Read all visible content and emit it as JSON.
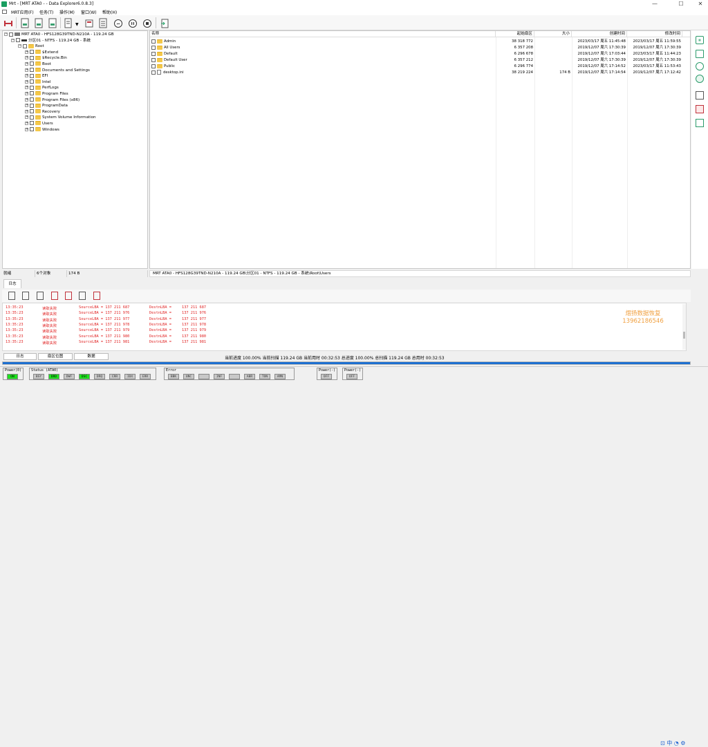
{
  "window": {
    "title": "Mrt - [MRT ATA0 -  - Data Explorer6.0.8.3]",
    "minimize_glyph": "—",
    "maximize_glyph": "☐",
    "close_glyph": "✕"
  },
  "menu": [
    "MRT应用(F)",
    "任务(T)",
    "操作(M)",
    "窗口(W)",
    "帮助(H)"
  ],
  "toolbar_icons": [
    "disk-icon",
    "document-icon",
    "document-icon",
    "document-icon",
    "document-dropdown-icon",
    "copy-icon",
    "list-icon",
    "fast-backward-icon",
    "pause-icon",
    "stop-icon",
    "exit-icon"
  ],
  "tree": {
    "disk": "MRT ATA0 - HFS128G39TND-N210A - 119.24 GB",
    "partition": "分区01 - NTFS - 119.24 GB - 系统",
    "root": "Root",
    "folders": [
      "$Extend",
      "$Recycle.Bin",
      "Boot",
      "Documents and Settings",
      "EFI",
      "Intel",
      "PerfLogs",
      "Program Files",
      "Program Files (x86)",
      "ProgramData",
      "Recovery",
      "System Volume Information",
      "Users",
      "Windows"
    ]
  },
  "filelist": {
    "columns": {
      "name": "名称",
      "start_sector": "起始扇区",
      "size": "大小",
      "created": "创建时间",
      "modified": "修改时间"
    },
    "rows": [
      {
        "name": "Admin",
        "start": "38 318 772",
        "size": "",
        "created": "2023/03/17 周五 11:45:48",
        "modified": "2023/03/17 周五 11:59:55",
        "type": "folder"
      },
      {
        "name": "All Users",
        "start": "6 357 208",
        "size": "",
        "created": "2019/12/07 周六 17:30:39",
        "modified": "2019/12/07 周六 17:30:39",
        "type": "folder"
      },
      {
        "name": "Default",
        "start": "6 296 678",
        "size": "",
        "created": "2019/12/07 周六 17:03:44",
        "modified": "2023/03/17 周五 11:44:23",
        "type": "folder"
      },
      {
        "name": "Default User",
        "start": "6 357 212",
        "size": "",
        "created": "2019/12/07 周六 17:30:39",
        "modified": "2019/12/07 周六 17:30:39",
        "type": "folder"
      },
      {
        "name": "Public",
        "start": "6 296 774",
        "size": "",
        "created": "2019/12/07 周六 17:14:52",
        "modified": "2023/03/17 周五 11:53:43",
        "type": "folder"
      },
      {
        "name": "desktop.ini",
        "start": "38 219 224",
        "size": "174 B",
        "created": "2019/12/07 周六 17:14:54",
        "modified": "2019/12/07 周六 17:12:42",
        "type": "file"
      }
    ]
  },
  "status": {
    "ready": "就绪",
    "count": "6个对象",
    "size": "174 B",
    "path": "MRT ATA0 - HFS128G39TND-N210A - 119.24 GB\\分区01 - NTFS - 119.24 GB - 系统\\Root\\Users"
  },
  "log": {
    "tab": "日志",
    "rows": [
      {
        "time": "13:35:23",
        "msg": "读取失败",
        "src": "SourceLBA = 137 211 687",
        "dst_label": "DestnLBA =",
        "dst": "137 211 687"
      },
      {
        "time": "13:35:23",
        "msg": "读取失败",
        "src": "SourceLBA = 137 211 976",
        "dst_label": "DestnLBA =",
        "dst": "137 211 976"
      },
      {
        "time": "13:35:23",
        "msg": "读取失败",
        "src": "SourceLBA = 137 211 977",
        "dst_label": "DestnLBA =",
        "dst": "137 211 977"
      },
      {
        "time": "13:35:23",
        "msg": "读取失败",
        "src": "SourceLBA = 137 211 978",
        "dst_label": "DestnLBA =",
        "dst": "137 211 978"
      },
      {
        "time": "13:35:23",
        "msg": "读取失败",
        "src": "SourceLBA = 137 211 979",
        "dst_label": "DestnLBA =",
        "dst": "137 211 979"
      },
      {
        "time": "13:35:23",
        "msg": "读取失败",
        "src": "SourceLBA = 137 211 980",
        "dst_label": "DestnLBA =",
        "dst": "137 211 980"
      },
      {
        "time": "13:35:23",
        "msg": "读取失败",
        "src": "SourceLBA = 137 211 981",
        "dst_label": "DestnLBA =",
        "dst": "137 211 981"
      }
    ],
    "watermark_line1": "熠扬数据恢复",
    "watermark_line2": "13962186546"
  },
  "bottom_tabs": [
    "日志",
    "扇区位图",
    "数据"
  ],
  "progress": {
    "text": "当前进度 100.00% 当前扫描 119.24 GB 当前用时 00:32:53   总进度 100.00% 总扫描 119.24 GB 总用时 00:32:53",
    "percent": 100,
    "fill_color": "#1d6fd0"
  },
  "statusbar": {
    "power0": {
      "label": "Power(0)",
      "indicators": [
        {
          "t": "ON",
          "on": true
        }
      ]
    },
    "status": {
      "label": "Status (ATA0)",
      "indicators": [
        {
          "t": "BSY",
          "on": false
        },
        {
          "t": "DRD",
          "on": true
        },
        {
          "t": "DWF",
          "on": false
        },
        {
          "t": "DSC",
          "on": true
        },
        {
          "t": "DRQ",
          "on": false
        },
        {
          "t": "CRR",
          "on": false
        },
        {
          "t": "IDX",
          "on": false
        },
        {
          "t": "ERR",
          "on": false
        }
      ]
    },
    "error": {
      "label": "Error",
      "indicators": [
        {
          "t": "BBK",
          "on": false
        },
        {
          "t": "UNC",
          "on": false
        },
        {
          "t": "",
          "on": false
        },
        {
          "t": "INF",
          "on": false
        },
        {
          "t": "",
          "on": false
        },
        {
          "t": "ABR",
          "on": false
        },
        {
          "t": "TON",
          "on": false
        },
        {
          "t": "AMN",
          "on": false
        }
      ]
    },
    "power_a": {
      "label": "Power(-)",
      "indicators": [
        {
          "t": "OFF",
          "on": false
        }
      ]
    },
    "power_b": {
      "label": "Power(-)",
      "indicators": [
        {
          "t": "OFF",
          "on": false
        }
      ]
    },
    "on_color": "#1ee21e"
  },
  "tray": "⊡ 中 ◔ ⚙"
}
